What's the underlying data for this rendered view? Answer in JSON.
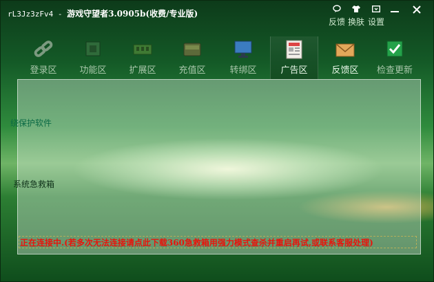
{
  "window": {
    "id_text": "rL3Jz3zFv4",
    "separator": "-",
    "app_title": "游戏守望者3.0905b(收费/专业版)"
  },
  "toolbar_mini": [
    {
      "label": "反馈",
      "icon": "chat-bubble-icon"
    },
    {
      "label": "换肤",
      "icon": "tshirt-icon"
    },
    {
      "label": "设置",
      "icon": "settings-icon"
    }
  ],
  "nav": [
    {
      "label": "登录区",
      "icon": "chain-link-icon",
      "color": "#6e8f74"
    },
    {
      "label": "功能区",
      "icon": "chip-icon",
      "color": "#2f6b3a"
    },
    {
      "label": "扩展区",
      "icon": "memory-module-icon",
      "color": "#3f7a33"
    },
    {
      "label": "充值区",
      "icon": "wallet-icon",
      "color": "#5d6a3a"
    },
    {
      "label": "转绑区",
      "icon": "monitor-icon",
      "color": "#3b7cc0"
    },
    {
      "label": "广告区",
      "icon": "newspaper-icon",
      "color": "#e9e4dc"
    },
    {
      "label": "反馈区",
      "icon": "envelope-icon",
      "color": "#e3a85a"
    },
    {
      "label": "检查更新",
      "icon": "checkbox-icon",
      "color": "#24a24a"
    }
  ],
  "active_nav": "广告区",
  "sidebar_items": [
    "绕保护软件",
    "系统急救箱"
  ],
  "status_message": "正在连接中.(若多次无法连接请点此下载360急救箱用强力模式查杀并重启再试,或联系客服处理)"
}
